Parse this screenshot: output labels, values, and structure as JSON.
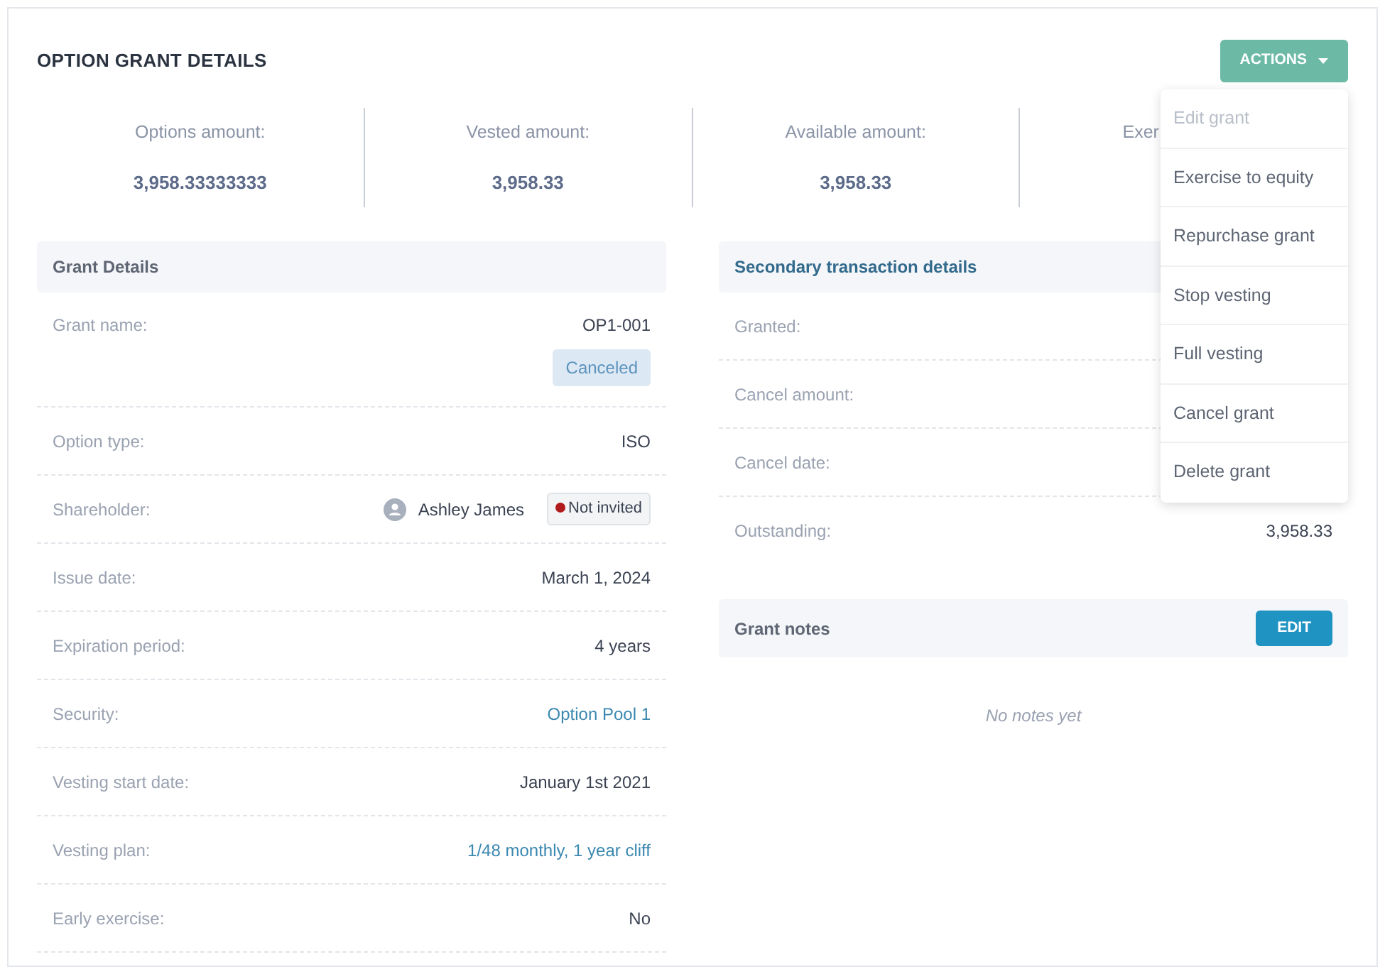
{
  "title": "OPTION GRANT DETAILS",
  "actions": {
    "label": "ACTIONS",
    "expanded": true,
    "menu": [
      {
        "label": "Edit grant",
        "disabled": true
      },
      {
        "label": "Exercise to equity",
        "disabled": false
      },
      {
        "label": "Repurchase grant",
        "disabled": false
      },
      {
        "label": "Stop vesting",
        "disabled": false
      },
      {
        "label": "Full vesting",
        "disabled": false
      },
      {
        "label": "Cancel grant",
        "disabled": false
      },
      {
        "label": "Delete grant",
        "disabled": false
      }
    ]
  },
  "stats": [
    {
      "label": "Options amount:",
      "value": "3,958.33333333"
    },
    {
      "label": "Vested amount:",
      "value": "3,958.33"
    },
    {
      "label": "Available amount:",
      "value": "3,958.33"
    },
    {
      "label": "Exer"
    }
  ],
  "grant_details": {
    "title": "Grant Details",
    "rows": [
      {
        "label": "Grant name:",
        "kind": "text",
        "value": "OP1-001",
        "status": "Canceled"
      },
      {
        "label": "Option type:",
        "kind": "text",
        "value": "ISO"
      },
      {
        "label": "Shareholder:",
        "kind": "person",
        "value": "Ashley James",
        "invite": "Not invited"
      },
      {
        "label": "Issue date:",
        "kind": "text",
        "value": "March 1, 2024"
      },
      {
        "label": "Expiration period:",
        "kind": "text",
        "value": "4 years"
      },
      {
        "label": "Security:",
        "kind": "link",
        "value": "Option Pool 1"
      },
      {
        "label": "Vesting start date:",
        "kind": "text",
        "value": "January 1st 2021"
      },
      {
        "label": "Vesting plan:",
        "kind": "link",
        "value": "1/48 monthly, 1 year cliff"
      },
      {
        "label": "Early exercise:",
        "kind": "text",
        "value": "No"
      }
    ]
  },
  "secondary": {
    "title": "Secondary transaction details",
    "rows": [
      {
        "label": "Granted:"
      },
      {
        "label": "Cancel amount:"
      },
      {
        "label": "Cancel date:"
      },
      {
        "label": "Outstanding:",
        "value": "3,958.33"
      }
    ]
  },
  "notes": {
    "title": "Grant notes",
    "button": "EDIT",
    "empty": "No notes yet"
  }
}
